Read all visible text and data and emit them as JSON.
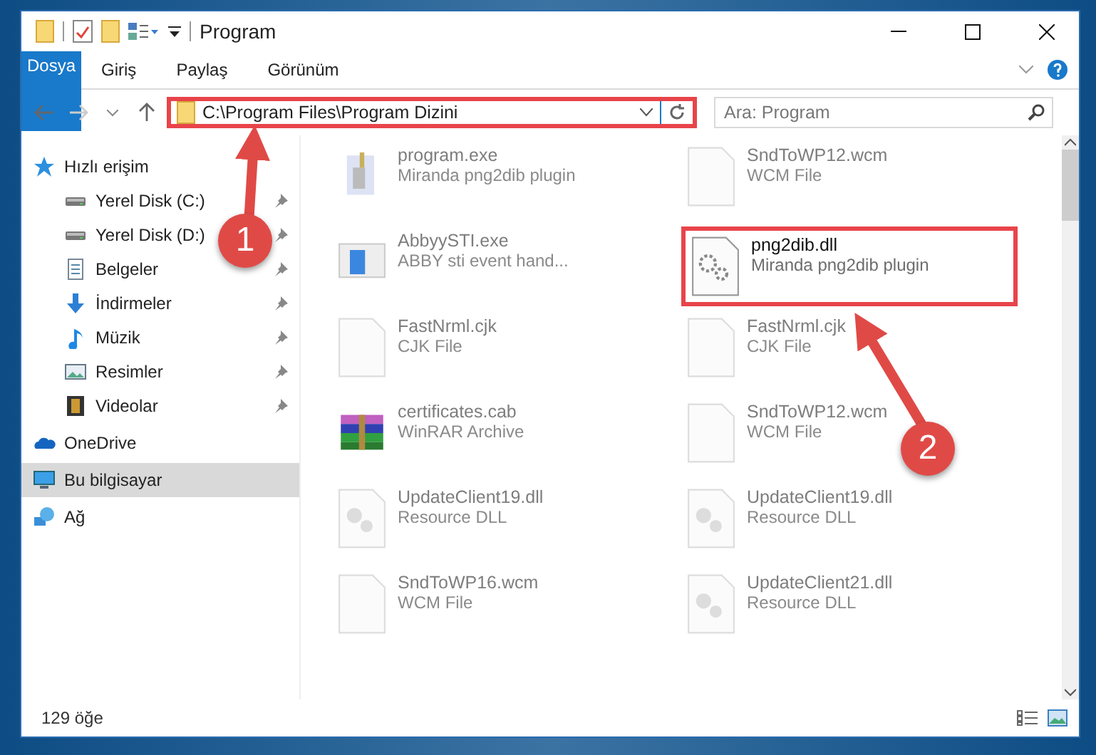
{
  "window": {
    "title": "Program"
  },
  "ribbon": {
    "tabs": [
      {
        "label": "Dosya",
        "kind": "file"
      },
      {
        "label": "Giriş",
        "kind": "tab"
      },
      {
        "label": "Paylaş",
        "kind": "tab"
      },
      {
        "label": "Görünüm",
        "kind": "tab"
      }
    ]
  },
  "address_bar": {
    "path": "C:\\Program Files\\Program Dizini",
    "highlighted": true
  },
  "search": {
    "placeholder": "Ara: Program"
  },
  "sidebar": {
    "items": [
      {
        "label": "Hızlı erişim",
        "kind": "star",
        "selected": false,
        "children": [
          {
            "label": "Yerel Disk (C:)",
            "kind": "drive",
            "pinned": true
          },
          {
            "label": "Yerel Disk (D:)",
            "kind": "drive",
            "pinned": true
          },
          {
            "label": "Belgeler",
            "kind": "documents",
            "pinned": true
          },
          {
            "label": "İndirmeler",
            "kind": "downloads",
            "pinned": true
          },
          {
            "label": "Müzik",
            "kind": "music",
            "pinned": true
          },
          {
            "label": "Resimler",
            "kind": "pictures",
            "pinned": true
          },
          {
            "label": "Videolar",
            "kind": "videos",
            "pinned": true
          }
        ]
      },
      {
        "label": "OneDrive",
        "kind": "cloud",
        "selected": false
      },
      {
        "label": "Bu bilgisayar",
        "kind": "computer",
        "selected": true
      },
      {
        "label": "Ağ",
        "kind": "network",
        "selected": false
      }
    ]
  },
  "files": [
    {
      "name": "program.exe",
      "description": "Miranda png2dib plugin",
      "kind": "installer",
      "highlighted": false
    },
    {
      "name": "SndToWP12.wcm",
      "description": "WCM File",
      "kind": "blank",
      "highlighted": false
    },
    {
      "name": "AbbyySTI.exe",
      "description": "ABBY sti event hand...",
      "kind": "window",
      "highlighted": false
    },
    {
      "name": "png2dib.dll",
      "description": "Miranda png2dib plugin",
      "kind": "gears",
      "highlighted": true
    },
    {
      "name": "FastNrml.cjk",
      "description": "CJK File",
      "kind": "blank",
      "highlighted": false
    },
    {
      "name": "FastNrml.cjk",
      "description": "CJK File",
      "kind": "blank",
      "highlighted": false
    },
    {
      "name": "certificates.cab",
      "description": "WinRAR Archive",
      "kind": "archive",
      "highlighted": false
    },
    {
      "name": "SndToWP12.wcm",
      "description": "WCM File",
      "kind": "blank",
      "highlighted": false
    },
    {
      "name": "UpdateClient19.dll",
      "description": "Resource DLL",
      "kind": "dll",
      "highlighted": false
    },
    {
      "name": "UpdateClient19.dll",
      "description": "Resource DLL",
      "kind": "dll",
      "highlighted": false
    },
    {
      "name": "SndToWP16.wcm",
      "description": "WCM File",
      "kind": "blank",
      "highlighted": false
    },
    {
      "name": "UpdateClient21.dll",
      "description": "Resource DLL",
      "kind": "dll",
      "highlighted": false
    }
  ],
  "status_bar": {
    "item_count": "129 öğe"
  },
  "annotations": [
    {
      "label": "1"
    },
    {
      "label": "2"
    }
  ]
}
